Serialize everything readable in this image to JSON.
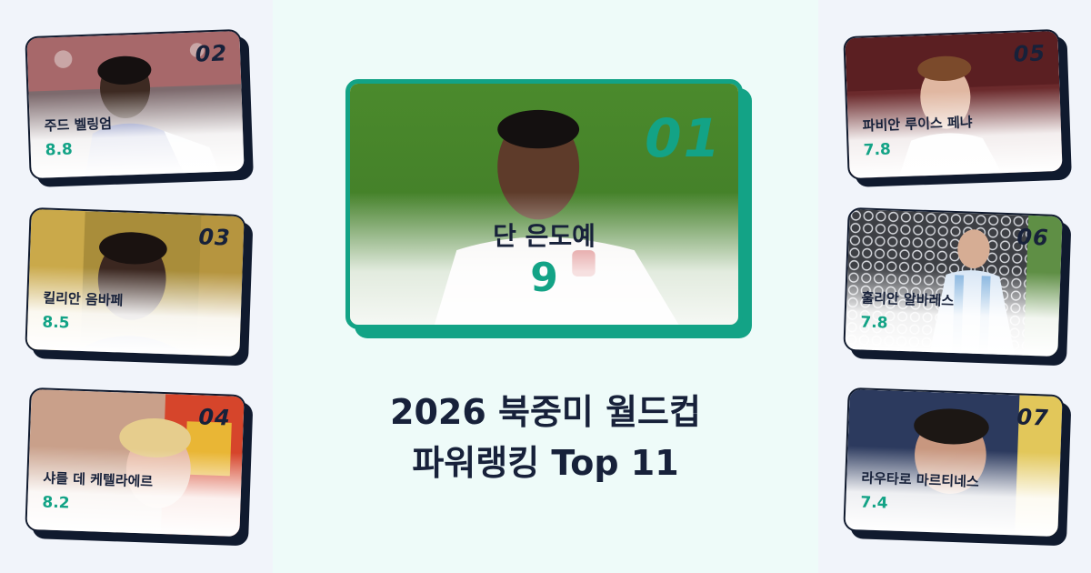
{
  "title": {
    "line1": "2026 북중미 월드컵",
    "line2": "파워랭킹 Top 11"
  },
  "featured": {
    "rank": "01",
    "name": "단 은도예",
    "score": "9"
  },
  "players": [
    {
      "rank": "02",
      "name": "주드 벨링엄",
      "score": "8.8"
    },
    {
      "rank": "03",
      "name": "킬리안 음바페",
      "score": "8.5"
    },
    {
      "rank": "04",
      "name": "샤를 데 케텔라에르",
      "score": "8.2"
    },
    {
      "rank": "05",
      "name": "파비안 루이스 페냐",
      "score": "7.8"
    },
    {
      "rank": "06",
      "name": "훌리안 알바레스",
      "score": "7.8"
    },
    {
      "rank": "07",
      "name": "라우타로 마르티네스",
      "score": "7.4"
    }
  ],
  "colors": {
    "accent": "#13a386",
    "dark": "#17213a",
    "card_shadow": "#101a2e",
    "center_bg": "#eefbf9",
    "side_bg": "#f1f4fa"
  }
}
